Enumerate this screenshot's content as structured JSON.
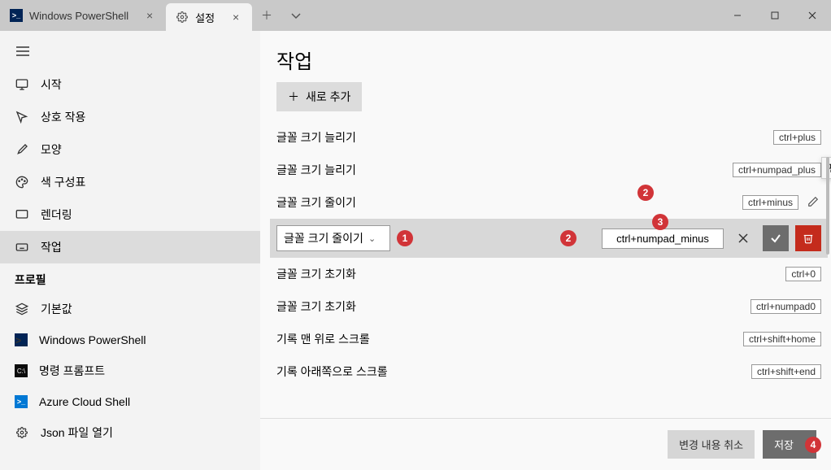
{
  "tabs": [
    {
      "title": "Windows PowerShell",
      "active": false
    },
    {
      "title": "설정",
      "active": true
    }
  ],
  "sidebar": {
    "items": [
      {
        "label": "시작"
      },
      {
        "label": "상호 작용"
      },
      {
        "label": "모양"
      },
      {
        "label": "색 구성표"
      },
      {
        "label": "렌더링"
      },
      {
        "label": "작업",
        "active": true
      }
    ],
    "section": "프로필",
    "profiles": [
      {
        "label": "기본값"
      },
      {
        "label": "Windows PowerShell"
      },
      {
        "label": "명령 프롬프트"
      },
      {
        "label": "Azure Cloud Shell"
      },
      {
        "label": "Json 파일 열기"
      }
    ]
  },
  "main": {
    "title": "작업",
    "add_label": "새로 추가",
    "tooltip": "편집",
    "rows": [
      {
        "label": "글꼴 크기 늘리기",
        "key": "ctrl+plus"
      },
      {
        "label": "글꼴 크기 늘리기",
        "key": "ctrl+numpad_plus",
        "showEdit": true
      },
      {
        "label": "글꼴 크기 줄이기",
        "key": "ctrl+minus",
        "showEdit": true
      },
      {
        "label": "글꼴 크기 줄이기",
        "key": "ctrl+numpad_minus",
        "editing": true
      },
      {
        "label": "글꼴 크기 초기화",
        "key": "ctrl+0"
      },
      {
        "label": "글꼴 크기 초기화",
        "key": "ctrl+numpad0"
      },
      {
        "label": "기록 맨 위로 스크롤",
        "key": "ctrl+shift+home"
      },
      {
        "label": "기록 아래쪽으로 스크롤",
        "key": "ctrl+shift+end"
      }
    ]
  },
  "footer": {
    "discard": "변경 내용 취소",
    "save": "저장"
  },
  "annotations": [
    "1",
    "2",
    "2",
    "3",
    "4"
  ]
}
